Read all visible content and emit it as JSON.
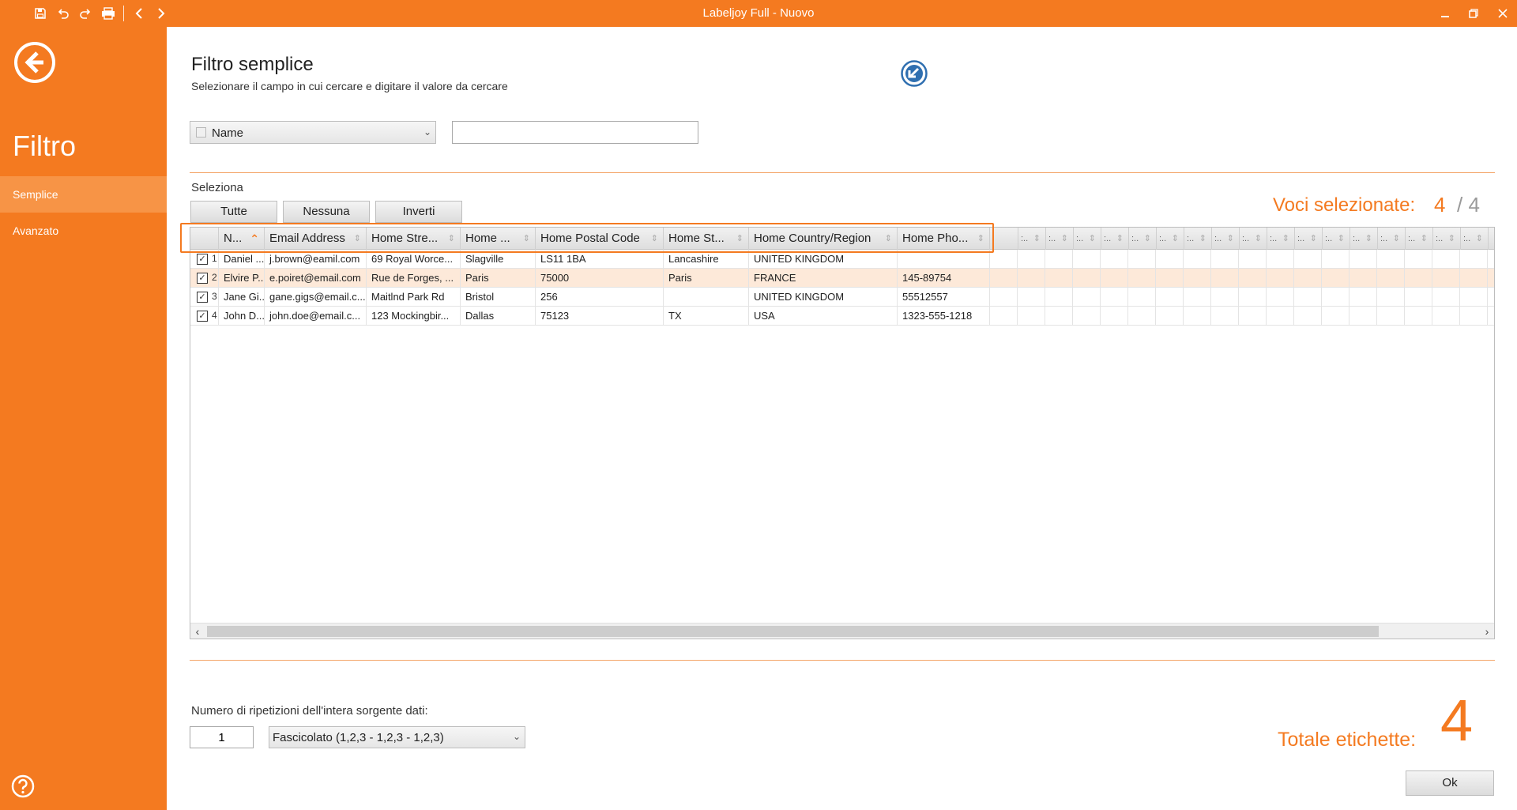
{
  "window": {
    "title": "Labeljoy Full - Nuovo",
    "toolbar_icons": [
      "save-icon",
      "undo-icon",
      "redo-icon",
      "print-icon",
      "arrow-left-icon",
      "arrow-right-icon"
    ],
    "controls": [
      "minimize-icon",
      "restore-icon",
      "close-icon"
    ],
    "accent_color": "#f47a20"
  },
  "sidebar": {
    "back_icon": "back-arrow-icon",
    "title": "Filtro",
    "items": [
      {
        "label": "Semplice",
        "active": true
      },
      {
        "label": "Avanzato",
        "active": false
      }
    ],
    "help_icon": "help-icon"
  },
  "main": {
    "title": "Filtro semplice",
    "subtitle": "Selezionare il campo in cui cercare e digitare il valore da cercare",
    "reset_icon": "reset-filter-icon",
    "field_select": {
      "value": "Name"
    },
    "search": {
      "value": "",
      "placeholder": ""
    },
    "selection": {
      "label": "Seleziona",
      "buttons": [
        "Tutte",
        "Nessuna",
        "Inverti"
      ],
      "count_label": "Voci selezionate:",
      "selected": "4",
      "total": "/ 4"
    }
  },
  "grid": {
    "columns": [
      "N...",
      "Email Address",
      "Home Stre...",
      "Home ...",
      "Home Postal Code",
      "Home St...",
      "Home Country/Region",
      "Home Pho..."
    ],
    "extra_column_label": ":..",
    "sorted_column_index": 0,
    "rows": [
      {
        "num": "1",
        "checked": true,
        "cells": [
          "Daniel ...",
          "j.brown@eamil.com",
          "69 Royal Worce...",
          "Slagville",
          "LS11 1BA",
          "Lancashire",
          "UNITED KINGDOM",
          ""
        ]
      },
      {
        "num": "2",
        "checked": true,
        "cells": [
          "Elvire P...",
          "e.poiret@email.com",
          "Rue de Forges, ...",
          "Paris",
          "75000",
          "Paris",
          "FRANCE",
          "145-89754"
        ]
      },
      {
        "num": "3",
        "checked": true,
        "cells": [
          "Jane Gi...",
          "gane.gigs@email.c...",
          "Maitlnd Park Rd",
          "Bristol",
          "256",
          "",
          "UNITED KINGDOM",
          "55512557"
        ]
      },
      {
        "num": "4",
        "checked": true,
        "cells": [
          "John D...",
          "john.doe@email.c...",
          "123 Mockingbir...",
          "Dallas",
          "75123",
          "TX",
          "USA",
          "1323-555-1218"
        ]
      }
    ]
  },
  "footer": {
    "repeat_label": "Numero di ripetizioni dell'intera sorgente dati:",
    "repeat_value": "1",
    "collate_value": "Fascicolato (1,2,3 - 1,2,3 - 1,2,3)",
    "total_label": "Totale etichette:",
    "total_value": "4",
    "ok_label": "Ok"
  }
}
